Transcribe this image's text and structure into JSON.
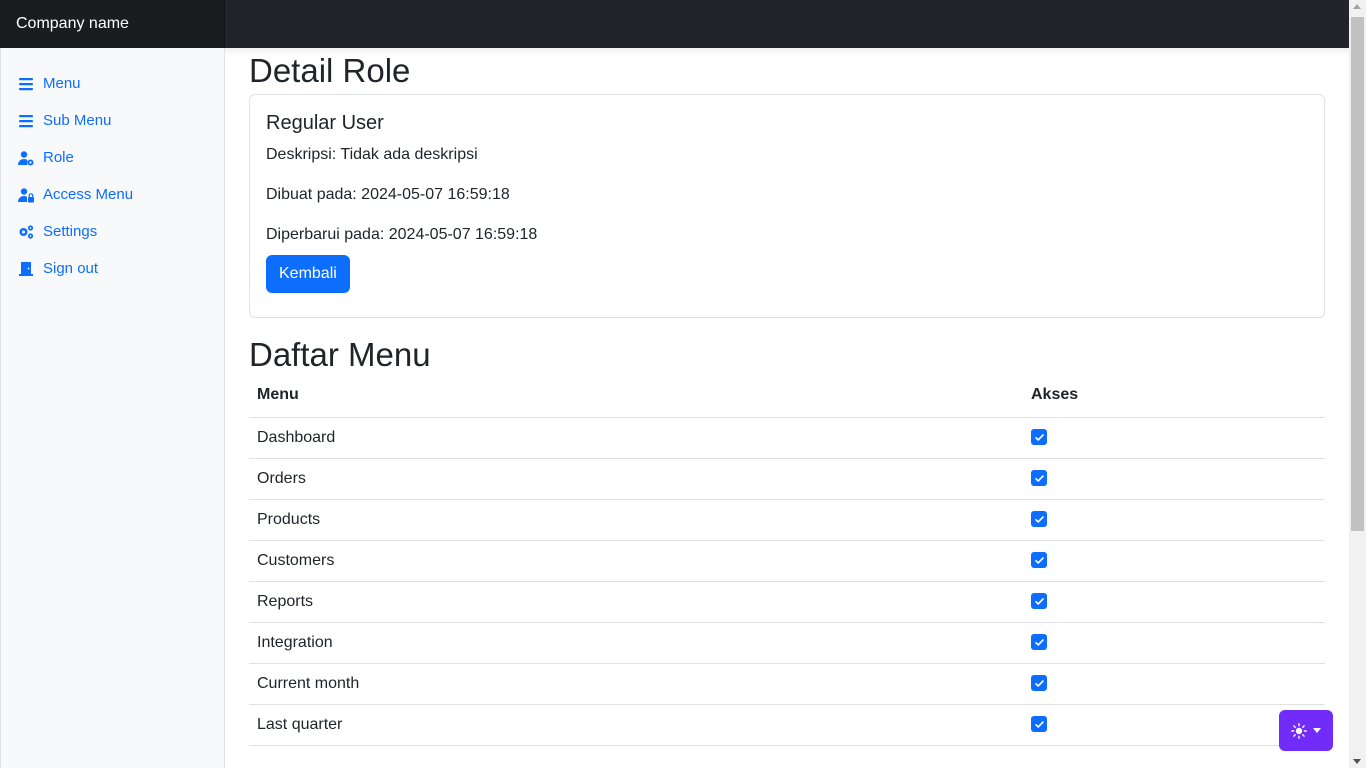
{
  "navbar": {
    "brand": "Company name"
  },
  "sidebar": {
    "items": [
      {
        "label": "Menu",
        "icon": "list-icon"
      },
      {
        "label": "Sub Menu",
        "icon": "list-icon"
      },
      {
        "label": "Role",
        "icon": "user-gear-icon"
      },
      {
        "label": "Access Menu",
        "icon": "user-lock-icon"
      },
      {
        "label": "Settings",
        "icon": "gears-icon"
      },
      {
        "label": "Sign out",
        "icon": "door-icon"
      }
    ]
  },
  "main": {
    "title": "Detail Role",
    "role": {
      "name": "Regular User",
      "description": "Deskripsi: Tidak ada deskripsi",
      "created": "Dibuat pada: 2024-05-07 16:59:18",
      "updated": "Diperbarui pada: 2024-05-07 16:59:18",
      "back_label": "Kembali"
    },
    "menu_section_title": "Daftar Menu",
    "table": {
      "headers": [
        "Menu",
        "Akses"
      ],
      "rows": [
        {
          "menu": "Dashboard",
          "access": true
        },
        {
          "menu": "Orders",
          "access": true
        },
        {
          "menu": "Products",
          "access": true
        },
        {
          "menu": "Customers",
          "access": true
        },
        {
          "menu": "Reports",
          "access": true
        },
        {
          "menu": "Integration",
          "access": true
        },
        {
          "menu": "Current month",
          "access": true
        },
        {
          "menu": "Last quarter",
          "access": true
        }
      ]
    }
  },
  "colors": {
    "primary": "#0d6efd",
    "navbar": "#212529",
    "theme_toggle": "#712cf9"
  }
}
